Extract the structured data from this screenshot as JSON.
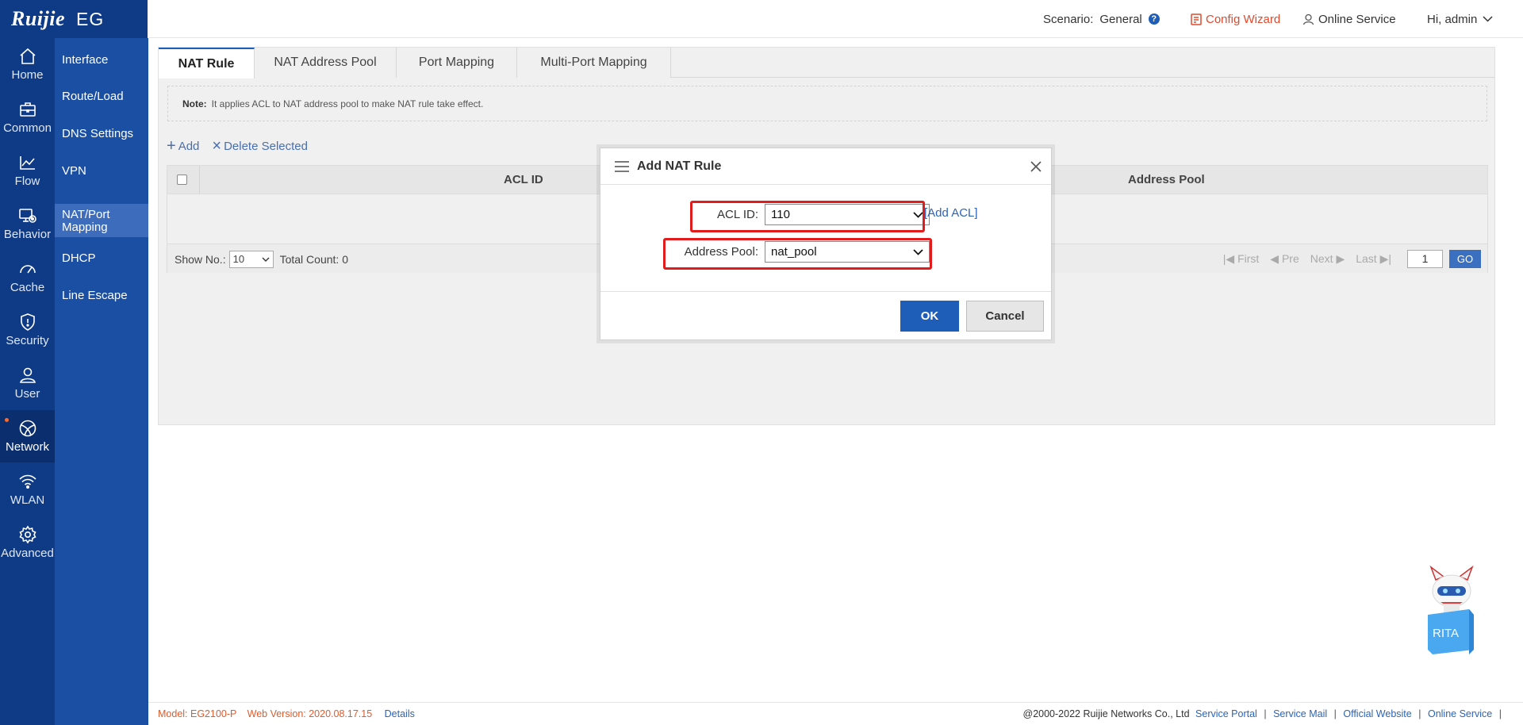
{
  "brand": {
    "logo_text": "Ruijie",
    "model_short": "EG"
  },
  "rail": {
    "items": [
      {
        "label": "Home",
        "icon": "home-icon"
      },
      {
        "label": "Common",
        "icon": "toolbox-icon"
      },
      {
        "label": "Flow",
        "icon": "line-chart-icon"
      },
      {
        "label": "Behavior",
        "icon": "monitor-icon"
      },
      {
        "label": "Cache",
        "icon": "gauge-icon"
      },
      {
        "label": "Security",
        "icon": "shield-icon"
      },
      {
        "label": "User",
        "icon": "user-icon"
      },
      {
        "label": "Network",
        "icon": "globe-icon",
        "active": true
      },
      {
        "label": "WLAN",
        "icon": "wifi-icon"
      },
      {
        "label": "Advanced",
        "icon": "gear-icon"
      }
    ]
  },
  "submenu": {
    "items": [
      {
        "label": "Interface"
      },
      {
        "label": "Route/Load"
      },
      {
        "label": "DNS Settings"
      },
      {
        "label": "VPN"
      },
      {
        "label": "NAT/Port\nMapping",
        "active": true
      },
      {
        "label": "DHCP"
      },
      {
        "label": "Line Escape"
      }
    ]
  },
  "header": {
    "scenario_label": "Scenario:",
    "scenario_value": "General",
    "help_glyph": "?",
    "wizard": "Config Wizard",
    "online_service": "Online Service",
    "greeting": "Hi, admin"
  },
  "tabs": [
    "NAT Rule",
    "NAT Address Pool",
    "Port Mapping",
    "Multi-Port Mapping"
  ],
  "note": {
    "label": "Note:",
    "text": "It applies ACL to NAT address pool to make NAT rule take effect."
  },
  "toolbar": {
    "add": "Add",
    "delete": "Delete Selected"
  },
  "table": {
    "columns": [
      "ACL ID",
      "Address Pool"
    ]
  },
  "pager": {
    "show_label": "Show No.:",
    "show_value": "10",
    "total": "Total Count: 0",
    "first": "First",
    "pre": "Pre",
    "next": "Next",
    "last": "Last",
    "page": "1",
    "go": "GO"
  },
  "dialog": {
    "title": "Add NAT Rule",
    "acl_label": "ACL ID:",
    "acl_value": "110",
    "add_acl": "[Add ACL]",
    "pool_label": "Address Pool:",
    "pool_value": "nat_pool",
    "ok": "OK",
    "cancel": "Cancel"
  },
  "footer": {
    "model": "Model:  EG2100-P",
    "web_version": "Web Version:  2020.08.17.15",
    "details": "Details",
    "copyright": "@2000-2022 Ruijie Networks Co., Ltd",
    "links": [
      "Service Portal",
      "Service Mail",
      "Official Website",
      "Online Service"
    ]
  },
  "rita": {
    "label": "RITA"
  },
  "colors": {
    "rail": "#0f3b86",
    "submenu": "#1a4fa3",
    "accent": "#1f5eb8",
    "wizard": "#e04a2e",
    "highlight": "#e01c1c"
  }
}
